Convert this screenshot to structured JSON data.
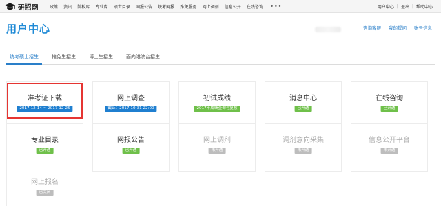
{
  "topbar": {
    "logo_text": "研招网",
    "nav_items": [
      "政策",
      "资讯",
      "院校库",
      "专业库",
      "硕士目录",
      "网报公告",
      "统考网报",
      "推免服务",
      "网上调剂",
      "信息公开",
      "在线咨询"
    ],
    "more": "•••",
    "right_links": [
      "用户中心",
      "退出",
      "帮助中心"
    ],
    "separator": "|"
  },
  "header": {
    "title": "用户中心",
    "links": [
      "咨询客服",
      "我的提问",
      "账号信息"
    ]
  },
  "tabs": [
    {
      "label": "统考硕士招生",
      "active": true
    },
    {
      "label": "推免生招生",
      "active": false
    },
    {
      "label": "博士生招生",
      "active": false
    },
    {
      "label": "面向港澳台招生",
      "active": false
    }
  ],
  "cards": [
    {
      "title": "准考证下载",
      "badge": "2017-12-14 ~ 2017-12-25",
      "status": "blue"
    },
    {
      "title": "网上调查",
      "badge": "截止：2017-10-31 22:00",
      "status": "blue"
    },
    {
      "title": "初试成绩",
      "badge": "2017年成绩查询与复核",
      "status": "green"
    },
    {
      "title": "消息中心",
      "badge": "已开通",
      "status": "green"
    },
    {
      "title": "在线咨询",
      "badge": "已开通",
      "status": "green"
    },
    {
      "title": "专业目录",
      "badge": "已开通",
      "status": "green"
    },
    {
      "title": "网报公告",
      "badge": "已开通",
      "status": "green"
    },
    {
      "title": "网上调剂",
      "badge": "未开通",
      "status": "gray"
    },
    {
      "title": "调剂意向采集",
      "badge": "未开通",
      "status": "gray"
    },
    {
      "title": "信息公开平台",
      "badge": "未开通",
      "status": "gray"
    },
    {
      "title": "网上报名",
      "badge": "已关闭",
      "status": "gray"
    }
  ],
  "colors": {
    "accent": "#1f8ad6",
    "badge_blue": "#1f7fd0",
    "badge_green": "#6fc04a",
    "badge_gray": "#bdbdbd",
    "highlight": "#e53532"
  }
}
